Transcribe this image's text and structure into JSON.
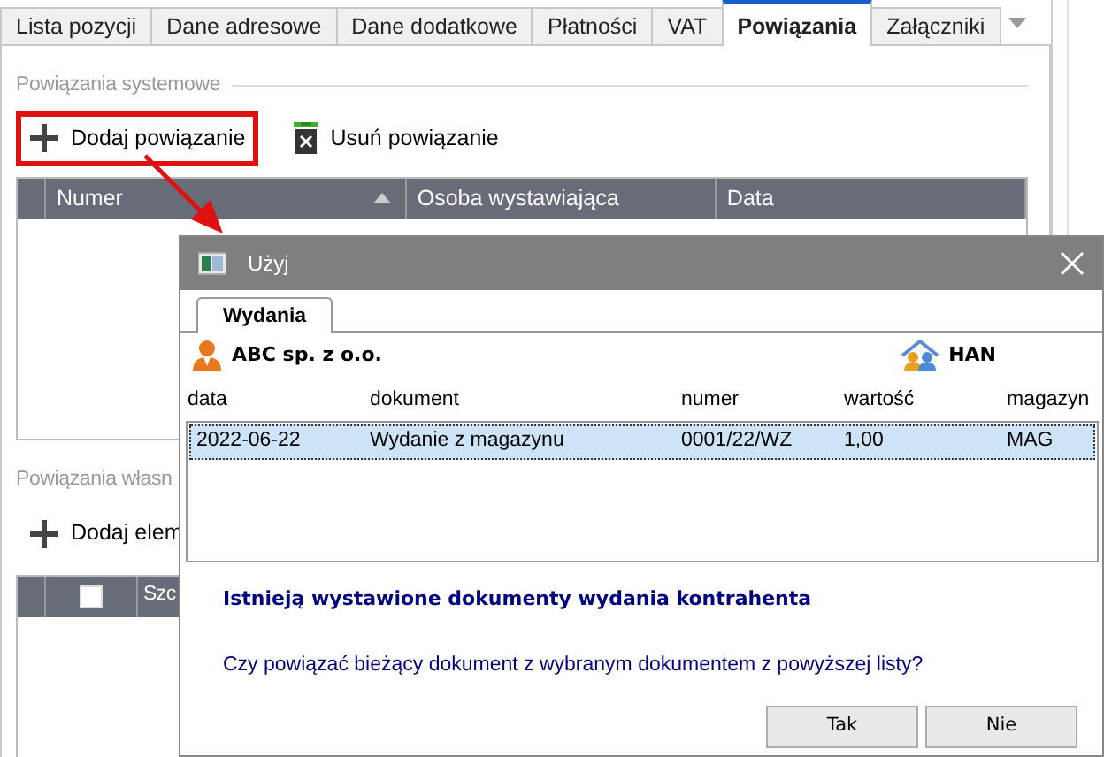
{
  "main_tabs": [
    {
      "label": "Lista pozycji",
      "selected": false
    },
    {
      "label": "Dane adresowe",
      "selected": false
    },
    {
      "label": "Dane dodatkowe",
      "selected": false
    },
    {
      "label": "Płatności",
      "selected": false
    },
    {
      "label": "VAT",
      "selected": false
    },
    {
      "label": "Powiązania",
      "selected": true
    },
    {
      "label": "Załączniki",
      "selected": false
    }
  ],
  "system_links": {
    "title": "Powiązania systemowe",
    "toolbar": [
      {
        "label": "Dodaj powiązanie",
        "kind": "add",
        "highlighted": true
      },
      {
        "label": "Usuń powiązanie",
        "kind": "delete",
        "highlighted": false
      }
    ],
    "columns": [
      {
        "label": "Numer",
        "sorted": true
      },
      {
        "label": "Osoba wystawiająca",
        "sorted": false
      },
      {
        "label": "Data",
        "sorted": false
      }
    ]
  },
  "own_links": {
    "title": "Powiązania własn",
    "toolbar": [
      {
        "label": "Dodaj elem",
        "kind": "add",
        "highlighted": false
      }
    ],
    "columns": [
      {
        "kind": "checkbox",
        "checked": false
      },
      {
        "kind": "text",
        "label": "Szc"
      }
    ]
  },
  "dialog": {
    "title": "Użyj",
    "tabs": [
      {
        "label": "Wydania",
        "selected": true
      }
    ],
    "customer": "ABC sp. z o.o.",
    "warehouse_code": "HAN",
    "columns": [
      "data",
      "dokument",
      "numer",
      "wartość",
      "magazyn"
    ],
    "rows": [
      {
        "cells": [
          "2022-06-22",
          "Wydanie z magazynu",
          "0001/22/WZ",
          "1,00",
          "MAG"
        ],
        "selected": true
      }
    ],
    "heading": "Istnieją wystawione dokumenty wydania kontrahenta",
    "question": "Czy powiązać bieżący dokument z wybranym dokumentem z powyższej listy?",
    "buttons": [
      "Tak",
      "Nie"
    ]
  }
}
